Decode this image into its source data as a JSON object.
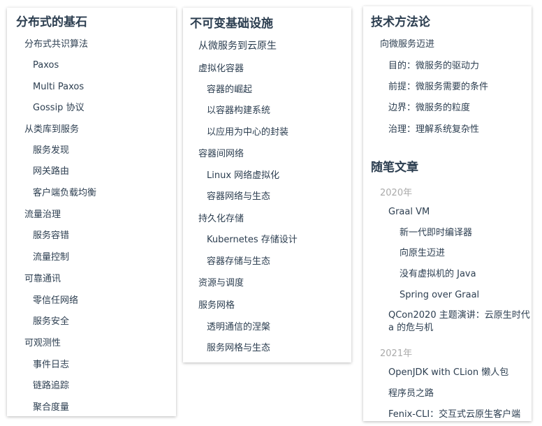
{
  "col1": {
    "title": "分布式的基石",
    "items": [
      "分布式共识算法",
      "Paxos",
      "Multi Paxos",
      "Gossip 协议",
      "从类库到服务",
      "服务发现",
      "网关路由",
      "客户端负载均衡",
      "流量治理",
      "服务容错",
      "流量控制",
      "可靠通讯",
      "零信任网络",
      "服务安全",
      "可观测性",
      "事件日志",
      "链路追踪",
      "聚合度量"
    ]
  },
  "col2": {
    "title": "不可变基础设施",
    "items": [
      "从微服务到云原生",
      "虚拟化容器",
      "容器的崛起",
      "以容器构建系统",
      "以应用为中心的封装",
      "容器间网络",
      "Linux 网络虚拟化",
      "容器网络与生态",
      "持久化存储",
      "Kubernetes 存储设计",
      "容器存储与生态",
      "资源与调度",
      "服务网格",
      "透明通信的涅槃",
      "服务网格与生态"
    ]
  },
  "col3": {
    "title": "技术方法论",
    "items": [
      "向微服务迈进",
      "目的：微服务的驱动力",
      "前提：微服务需要的条件",
      "边界：微服务的粒度",
      "治理：理解系统复杂性"
    ],
    "title2": "随笔文章",
    "essays": [
      "2020年",
      "Graal VM",
      "新一代即时编译器",
      "向原生迈进",
      "没有虚拟机的 Java",
      "Spring over Graal",
      "QCon2020 主题演讲：云原生时代 a 的危与机",
      "2021年",
      "OpenJDK with CLion 懒人包",
      "程序员之路",
      "Fenix-CLI：交互式云原生客户端"
    ]
  }
}
